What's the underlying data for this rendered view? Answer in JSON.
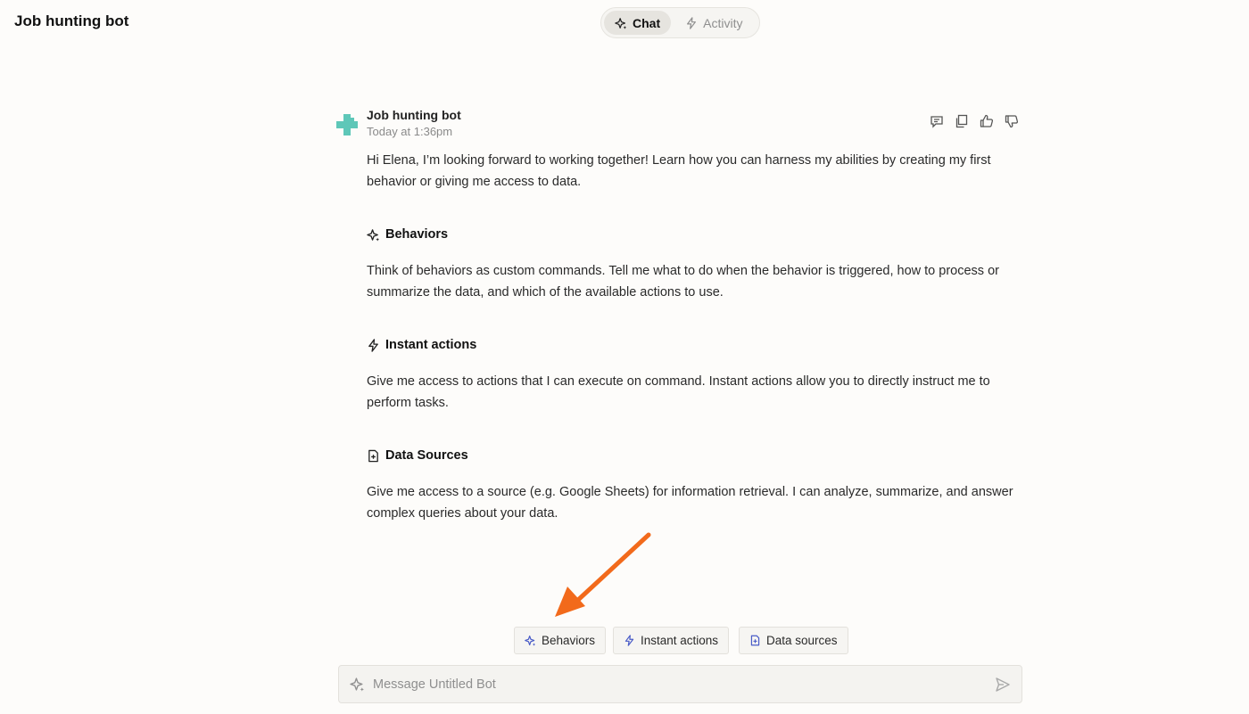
{
  "app": {
    "title": "Job hunting bot"
  },
  "tabs": [
    {
      "label": "Chat",
      "active": true,
      "icon": "sparkle-icon"
    },
    {
      "label": "Activity",
      "active": false,
      "icon": "lightning-icon"
    }
  ],
  "message": {
    "sender": "Job hunting bot",
    "timestamp": "Today at 1:36pm",
    "intro": "Hi Elena, I’m looking forward to working together! Learn how you can harness my abilities by creating my first behavior or giving me access to data.",
    "sections": [
      {
        "title": "Behaviors",
        "icon": "sparkle-icon",
        "body": "Think of behaviors as custom commands. Tell me what to do when the behavior is triggered, how to process or summarize the data, and which of the available actions to use."
      },
      {
        "title": "Instant actions",
        "icon": "lightning-icon",
        "body": "Give me access to actions that I can execute on command. Instant actions allow you to directly instruct me to perform tasks."
      },
      {
        "title": "Data Sources",
        "icon": "file-icon",
        "body": "Give me access to a source (e.g. Google Sheets) for information retrieval. I can analyze, summarize, and answer complex queries about your data."
      }
    ],
    "actions": [
      "comment-icon",
      "copy-icon",
      "thumbs-up-icon",
      "thumbs-down-icon"
    ]
  },
  "suggestions": [
    {
      "label": "Behaviors",
      "icon": "sparkle-icon"
    },
    {
      "label": "Instant actions",
      "icon": "lightning-icon"
    },
    {
      "label": "Data sources",
      "icon": "file-icon"
    }
  ],
  "composer": {
    "placeholder": "Message Untitled Bot",
    "value": ""
  },
  "colors": {
    "accent": "#4a5cc7",
    "avatar": "#5ec7b8",
    "annotation": "#f26a1b"
  }
}
